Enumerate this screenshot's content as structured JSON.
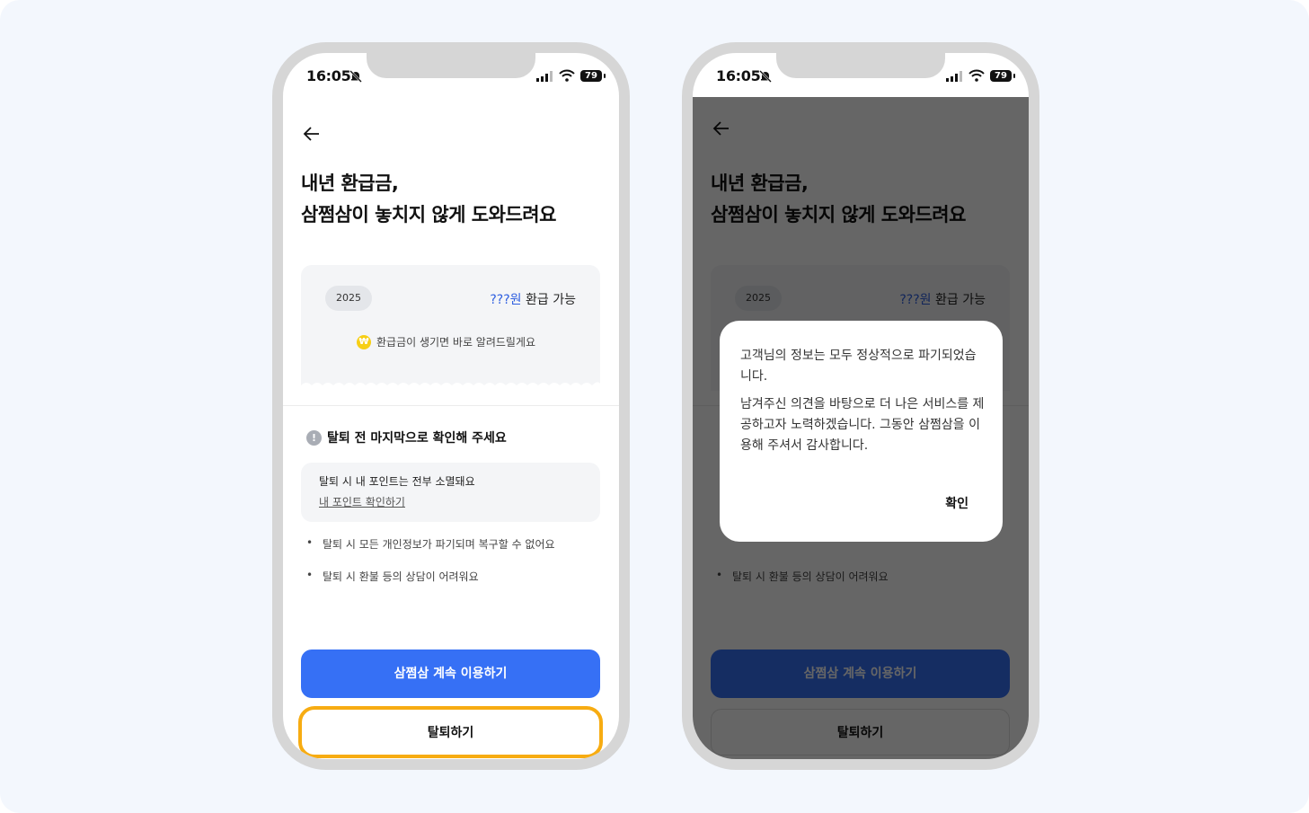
{
  "status_bar": {
    "time": "16:05",
    "battery": "79"
  },
  "main": {
    "headline_line1": "내년 환급금,",
    "headline_line2": "삼쩜삼이 놓치지 않게 도와드려요",
    "refund_card": {
      "year": "2025",
      "amount": "???원",
      "amount_suffix": "환급 가능",
      "coin_glyph": "₩",
      "notice": "환급금이 생기면 바로 알려드릴게요"
    },
    "warning_title": "탈퇴 전 마지막으로 확인해 주세요",
    "point_box": {
      "text": "탈퇴 시 내 포인트는 전부 소멸돼요",
      "link": "내 포인트 확인하기"
    },
    "bullets": [
      "탈퇴 시 모든 개인정보가 파기되며 복구할 수 없어요",
      "탈퇴 시 환불 등의 상담이 어려워요"
    ],
    "primary_button": "삼쩜삼 계속 이용하기",
    "withdraw_button": "탈퇴하기"
  },
  "dialog": {
    "message1": "고객님의 정보는 모두 정상적으로 파기되었습니다.",
    "message2": "남겨주신 의견을 바탕으로 더 나은 서비스를 제공하고자 노력하겠습니다. 그동안 삼쩜삼을 이용해 주셔서 감사합니다.",
    "confirm": "확인"
  },
  "colors": {
    "background": "#f3f7fd",
    "primary": "#3670f5",
    "highlight": "#f7ac12",
    "amount_blue": "#2f5fe0",
    "coin": "#f7cf15"
  },
  "icons": [
    "back-arrow-icon",
    "bell-off-icon",
    "signal-icon",
    "wifi-icon",
    "battery-icon",
    "won-coin-icon",
    "exclamation-icon"
  ]
}
